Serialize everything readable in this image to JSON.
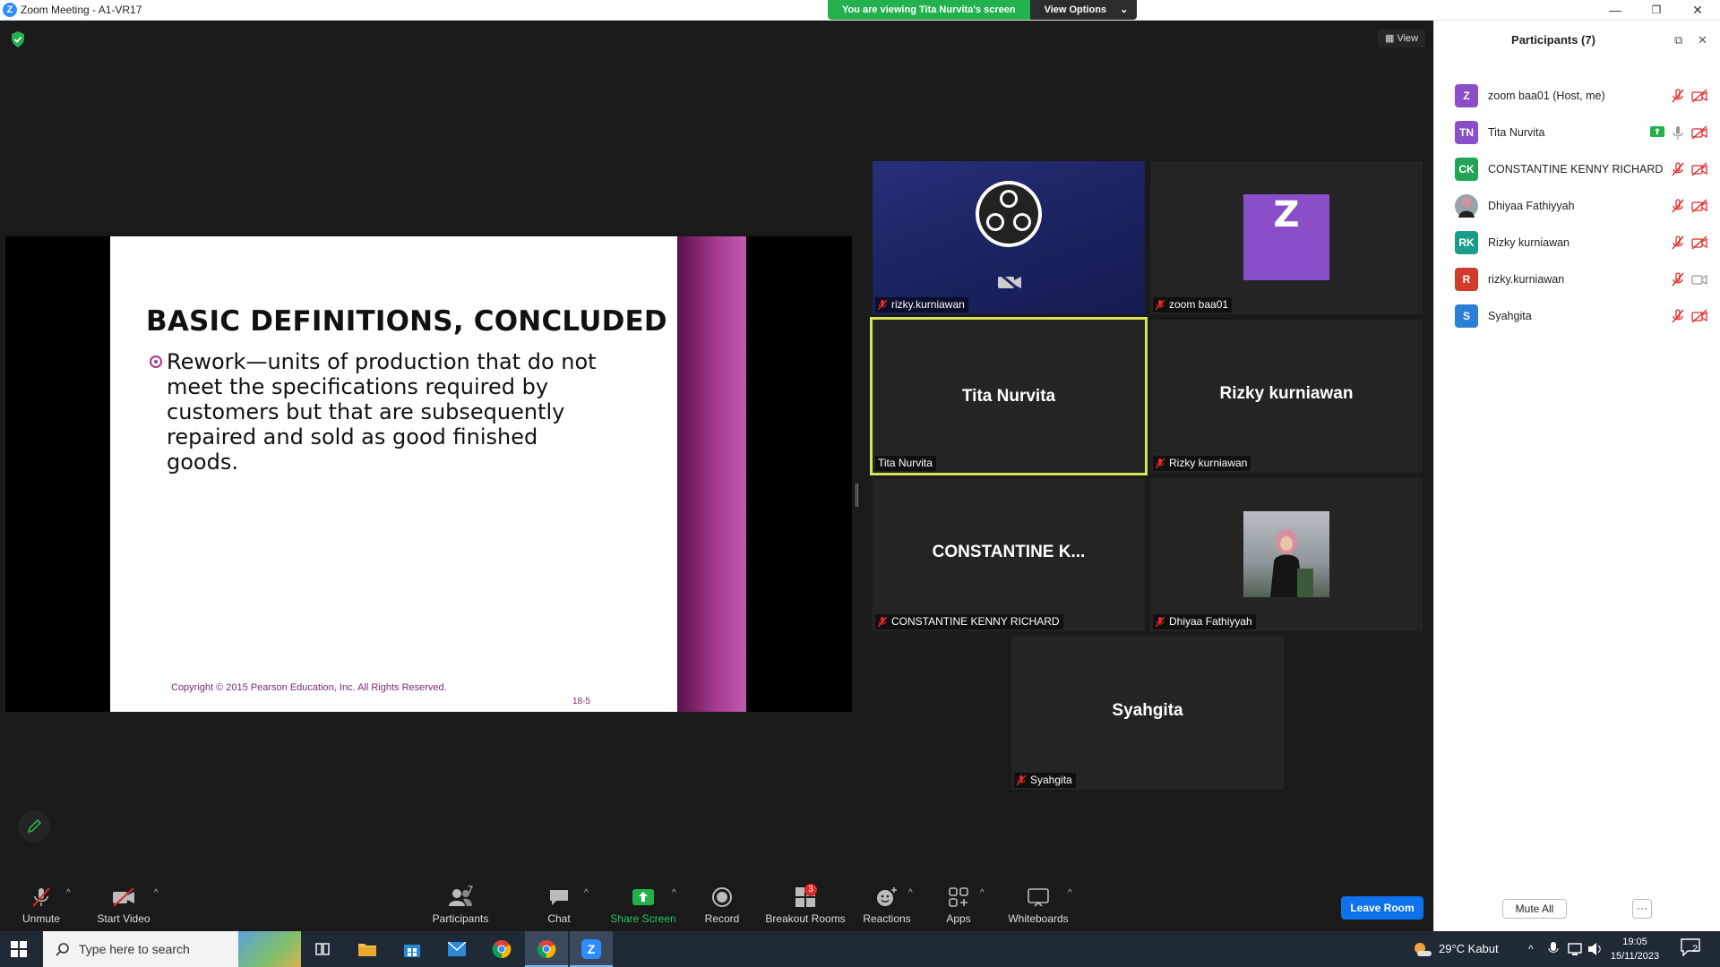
{
  "window": {
    "title": "Zoom Meeting - A1-VR17",
    "app_icon": "Z",
    "minimize_icon": "—",
    "restore_icon": "❐",
    "close_icon": "✕"
  },
  "banner": {
    "viewing": "You are viewing Tita Nurvita's screen",
    "options": "View Options",
    "options_caret": "⌄"
  },
  "view_button": "View",
  "slide": {
    "title": "BASIC DEFINITIONS, CONCLUDED",
    "body": "Rework—units of production that do not meet the specifications required by customers but that are subsequently repaired and sold as good finished goods.",
    "copyright": "Copyright © 2015 Pearson Education, Inc. All Rights Reserved.",
    "page": "18-5"
  },
  "tiles": [
    {
      "name": "rizky.kurniawan",
      "muted": true
    },
    {
      "name": "zoom baa01",
      "avatar": "Z",
      "muted": true
    },
    {
      "name": "Tita Nurvita",
      "big": "Tita Nurvita",
      "muted": false,
      "active": true
    },
    {
      "name": "Rizky kurniawan",
      "big": "Rizky kurniawan",
      "muted": true
    },
    {
      "name": "CONSTANTINE KENNY RICHARD",
      "big": "CONSTANTINE  K...",
      "muted": true
    },
    {
      "name": "Dhiyaa Fathiyyah",
      "muted": true
    },
    {
      "name": "Syahgita",
      "big": "Syahgita",
      "muted": true
    }
  ],
  "toolbar": {
    "unmute": "Unmute",
    "start_video": "Start Video",
    "participants": "Participants",
    "participants_count": "7",
    "chat": "Chat",
    "share_screen": "Share Screen",
    "record": "Record",
    "breakout_rooms": "Breakout Rooms",
    "breakout_badge": "3",
    "reactions": "Reactions",
    "apps": "Apps",
    "whiteboards": "Whiteboards",
    "leave": "Leave Room",
    "caret": "^"
  },
  "panel": {
    "title": "Participants (7)",
    "popout_icon": "⧉",
    "close_icon": "✕",
    "participants": [
      {
        "initials": "Z",
        "name": "zoom baa01 (Host, me)",
        "color": "#8a4ec8",
        "video": "off"
      },
      {
        "initials": "TN",
        "name": "Tita Nurvita",
        "color": "#8a4ec8",
        "video": "off",
        "sharing": true
      },
      {
        "initials": "CK",
        "name": "CONSTANTINE KENNY RICHARD",
        "color": "#23a455",
        "video": "off"
      },
      {
        "initials": "",
        "name": "Dhiyaa Fathiyyah",
        "color": "#9aa3a8",
        "video": "off",
        "photo": true
      },
      {
        "initials": "RK",
        "name": "Rizky kurniawan",
        "color": "#1a9c8c",
        "video": "off"
      },
      {
        "initials": "R",
        "name": "rizky.kurniawan",
        "color": "#d23a2c",
        "video": "on"
      },
      {
        "initials": "S",
        "name": "Syahgita",
        "color": "#2b7fd6",
        "video": "off"
      }
    ],
    "mute_all": "Mute All",
    "more": "···"
  },
  "taskbar": {
    "search_placeholder": "Type here to search",
    "weather": "29°C  Kabut",
    "tray_caret": "^",
    "time": "19:05",
    "date": "15/11/2023",
    "notifications": "2"
  },
  "colors": {
    "accent": "#0e72ed",
    "share_green": "#23b14d",
    "active_speaker": "#d7e55a",
    "mute_red": "#e02828"
  }
}
